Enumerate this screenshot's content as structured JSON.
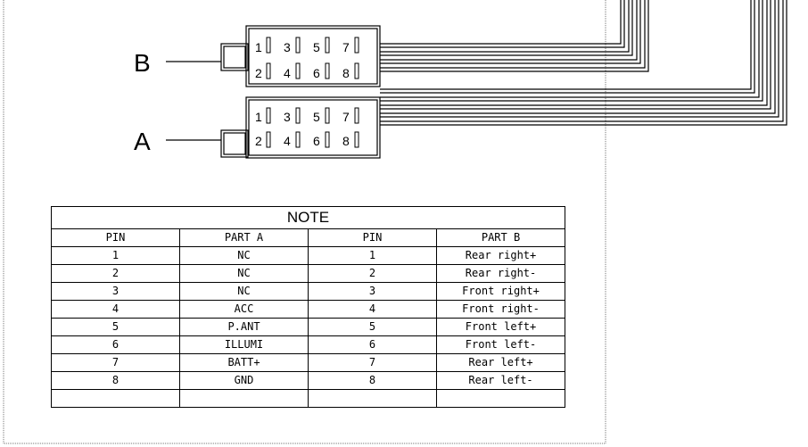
{
  "labels": {
    "connector_b": "B",
    "connector_a": "A"
  },
  "pins_top_row": [
    "1",
    "3",
    "5",
    "7"
  ],
  "pins_bottom_row": [
    "2",
    "4",
    "6",
    "8"
  ],
  "note": {
    "title": "NOTE",
    "headers": [
      "PIN",
      "PART A",
      "PIN",
      "PART B"
    ],
    "rows": [
      [
        "1",
        "NC",
        "1",
        "Rear right+"
      ],
      [
        "2",
        "NC",
        "2",
        "Rear right-"
      ],
      [
        "3",
        "NC",
        "3",
        "Front right+"
      ],
      [
        "4",
        "ACC",
        "4",
        "Front right-"
      ],
      [
        "5",
        "P.ANT",
        "5",
        "Front left+"
      ],
      [
        "6",
        "ILLUMI",
        "6",
        "Front left-"
      ],
      [
        "7",
        "BATT+",
        "7",
        "Rear left+"
      ],
      [
        "8",
        "GND",
        "8",
        "Rear left-"
      ]
    ]
  }
}
